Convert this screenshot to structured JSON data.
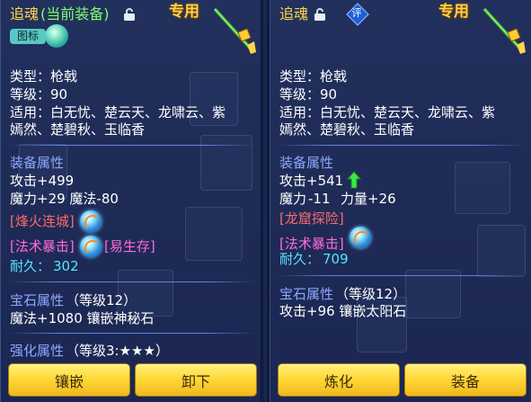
{
  "left": {
    "name": "追魂",
    "equipped_tag": "(当前装备)",
    "special_label": "专用",
    "badge_label": "图标",
    "type_line": "类型：枪戟",
    "level_line": "等级：90",
    "suits_line1": "适用：白无忧、楚云天、龙啸云、紫",
    "suits_line2": "嫣然、楚碧秋、玉临香",
    "equip_attr_title": "装备属性",
    "attack_line": "攻击+499",
    "magic_line": "魔力+29 魔法-80",
    "skill1": "[烽火连城]",
    "skill2": "[法术暴击]",
    "skill3": "[易生存]",
    "durability_label": "耐久：",
    "durability_value": "302",
    "gem_title": "宝石属性",
    "gem_level": "（等级12）",
    "gem_line": "魔法+1080 镶嵌神秘石",
    "enhance_title": "强化属性",
    "enhance_level": "（等级3:★★★）",
    "btn_inlay": "镶嵌",
    "btn_unequip": "卸下"
  },
  "right": {
    "name": "追魂",
    "special_label": "专用",
    "ping_label": "评",
    "type_line": "类型：枪戟",
    "level_line": "等级：90",
    "suits_line1": "适用：白无忧、楚云天、龙啸云、紫",
    "suits_line2": "嫣然、楚碧秋、玉临香",
    "equip_attr_title": "装备属性",
    "attack_line": "攻击+541",
    "magic_prefix": "魔力",
    "magic_value": "-11",
    "strength_part": "力量+26",
    "skill1": "[龙窟探险]",
    "skill2": "[法术暴击]",
    "durability_label": "耐久：",
    "durability_value": "709",
    "gem_title": "宝石属性",
    "gem_level": "（等级12）",
    "gem_line": "攻击+96 镶嵌太阳石",
    "btn_refine": "炼化",
    "btn_equip": "装备"
  },
  "colors": {
    "gold": "#ffd54a",
    "section_blue": "#8ea8ff",
    "equipped_green": "#7dff6b",
    "skill_red": "#ff6a6a",
    "skill_pink": "#ff6adf",
    "durability_cyan": "#55e6ff",
    "button_yellow": "#ffd93a"
  },
  "icons": [
    "lock-icon",
    "spear-icon",
    "orb-icon",
    "arrow-up-icon",
    "ping-badge-icon"
  ]
}
